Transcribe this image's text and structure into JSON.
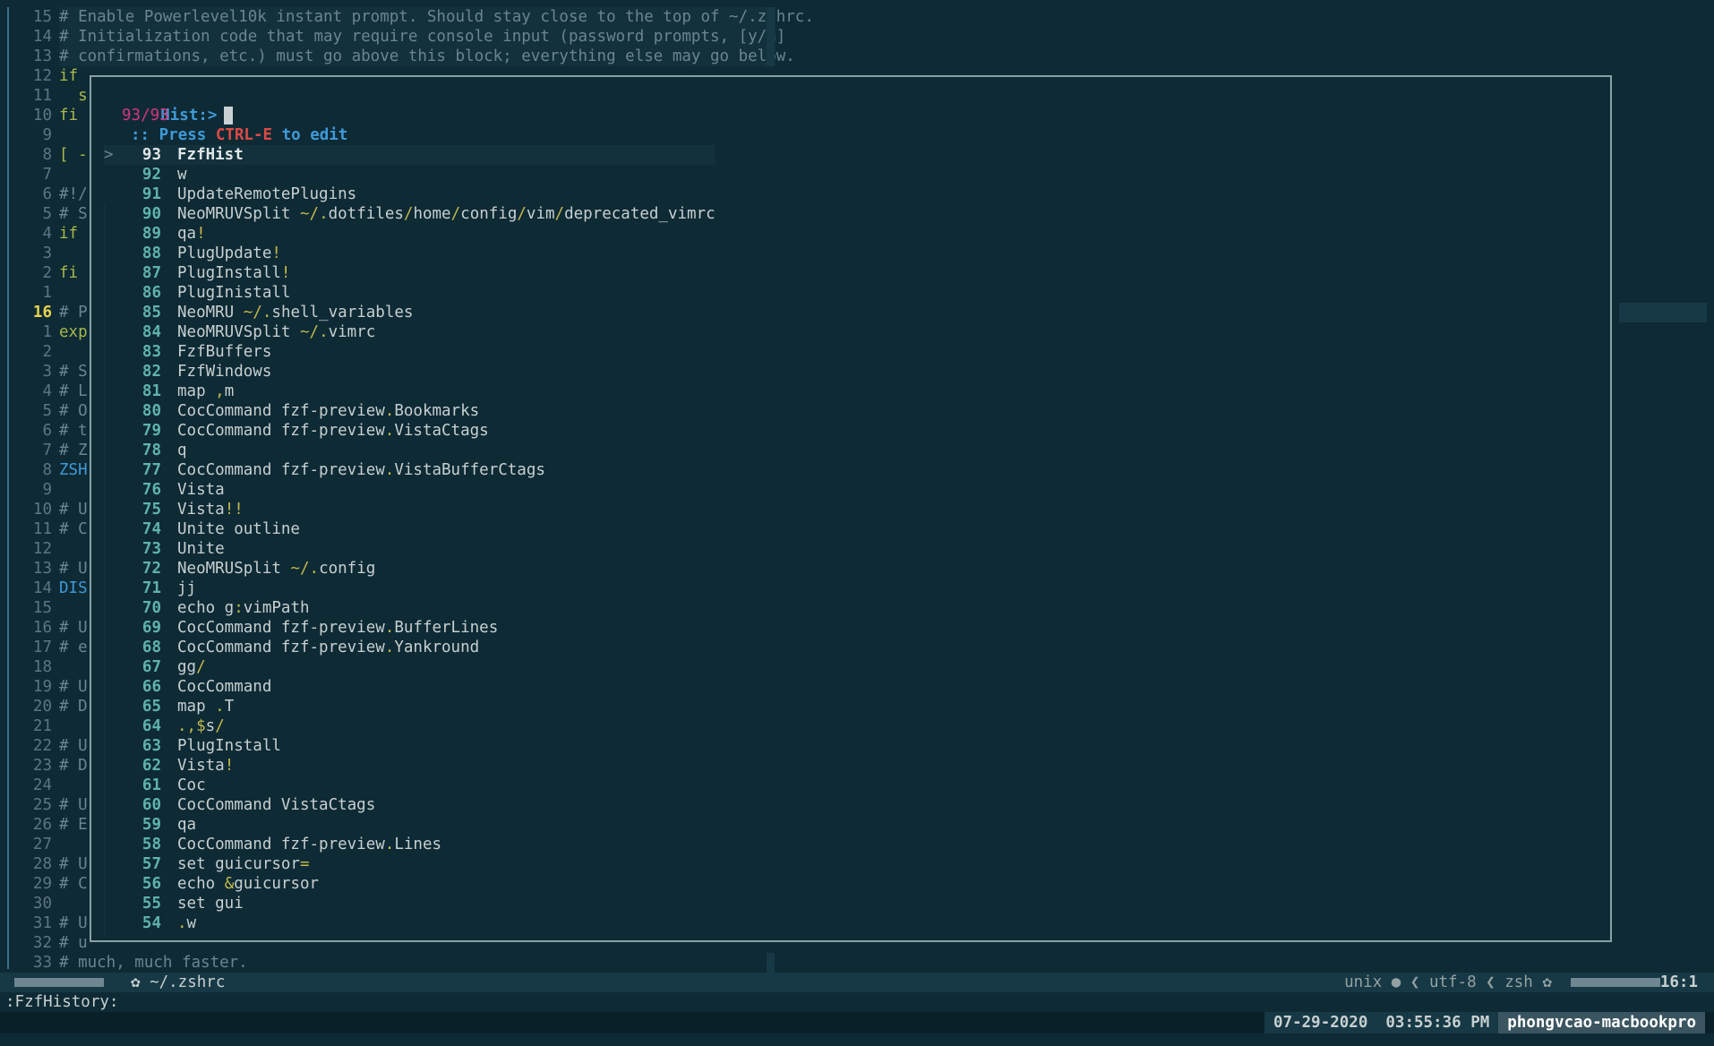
{
  "editor": {
    "gutter_numbers": [
      "15",
      "14",
      "13",
      "12",
      "11",
      "10",
      "9",
      "8",
      "7",
      "6",
      "5",
      "4",
      "3",
      "2",
      "1",
      "16",
      "1",
      "2",
      "3",
      "4",
      "5",
      "6",
      "7",
      "8",
      "9",
      "10",
      "11",
      "12",
      "13",
      "14",
      "15",
      "16",
      "17",
      "18",
      "19",
      "20",
      "21",
      "22",
      "23",
      "24",
      "25",
      "26",
      "27",
      "28",
      "29",
      "30",
      "31",
      "32",
      "33"
    ],
    "code_lines": [
      "# Enable Powerlevel10k instant prompt. Should stay close to the top of ~/.zshrc.",
      "# Initialization code that may require console input (password prompts, [y/n]",
      "# confirmations, etc.) must go above this block; everything else may go below.",
      "if",
      "  s",
      "fi",
      "",
      "[ -",
      "",
      "#!/",
      "# S",
      "if",
      "",
      "fi",
      "",
      "# P",
      "exp",
      "",
      "# S",
      "# L",
      "# O",
      "# t",
      "# Z",
      "ZSH",
      "",
      "# U",
      "# C",
      "",
      "# U",
      "DIS",
      "",
      "# U",
      "# e",
      "",
      "# U",
      "# D",
      "",
      "# U",
      "# D",
      "",
      "# U",
      "# E",
      "",
      "# U",
      "# C",
      "",
      "# U",
      "# u",
      "# much, much faster."
    ]
  },
  "popup": {
    "prompt_label": "Hist:>",
    "count": "93/93",
    "hint_prefix": ":: Press ",
    "hint_key": "CTRL-E",
    "hint_suffix": " to edit",
    "pointer": ">",
    "items": [
      {
        "n": "93",
        "cmd": "FzfHist"
      },
      {
        "n": "92",
        "cmd": "w"
      },
      {
        "n": "91",
        "cmd": "UpdateRemotePlugins"
      },
      {
        "n": "90",
        "cmd": "NeoMRUVSplit ~/.dotfiles/home/config/vim/deprecated_vimrc"
      },
      {
        "n": "89",
        "cmd": "qa!"
      },
      {
        "n": "88",
        "cmd": "PlugUpdate!"
      },
      {
        "n": "87",
        "cmd": "PlugInstall!"
      },
      {
        "n": "86",
        "cmd": "PlugInistall"
      },
      {
        "n": "85",
        "cmd": "NeoMRU ~/.shell_variables"
      },
      {
        "n": "84",
        "cmd": "NeoMRUVSplit ~/.vimrc"
      },
      {
        "n": "83",
        "cmd": "FzfBuffers"
      },
      {
        "n": "82",
        "cmd": "FzfWindows"
      },
      {
        "n": "81",
        "cmd": "map ,m"
      },
      {
        "n": "80",
        "cmd": "CocCommand fzf-preview.Bookmarks"
      },
      {
        "n": "79",
        "cmd": "CocCommand fzf-preview.VistaCtags"
      },
      {
        "n": "78",
        "cmd": "q"
      },
      {
        "n": "77",
        "cmd": "CocCommand fzf-preview.VistaBufferCtags"
      },
      {
        "n": "76",
        "cmd": "Vista"
      },
      {
        "n": "75",
        "cmd": "Vista!!"
      },
      {
        "n": "74",
        "cmd": "Unite outline"
      },
      {
        "n": "73",
        "cmd": "Unite"
      },
      {
        "n": "72",
        "cmd": "NeoMRUSplit ~/.config"
      },
      {
        "n": "71",
        "cmd": "jj"
      },
      {
        "n": "70",
        "cmd": "echo g:vimPath"
      },
      {
        "n": "69",
        "cmd": "CocCommand fzf-preview.BufferLines"
      },
      {
        "n": "68",
        "cmd": "CocCommand fzf-preview.Yankround"
      },
      {
        "n": "67",
        "cmd": "gg/"
      },
      {
        "n": "66",
        "cmd": "CocCommand"
      },
      {
        "n": "65",
        "cmd": "map .T"
      },
      {
        "n": "64",
        "cmd": ".,$s/"
      },
      {
        "n": "63",
        "cmd": "PlugInstall"
      },
      {
        "n": "62",
        "cmd": "Vista!"
      },
      {
        "n": "61",
        "cmd": "Coc"
      },
      {
        "n": "60",
        "cmd": "CocCommand VistaCtags"
      },
      {
        "n": "59",
        "cmd": "qa"
      },
      {
        "n": "58",
        "cmd": "CocCommand fzf-preview.Lines"
      },
      {
        "n": "57",
        "cmd": "set guicursor="
      },
      {
        "n": "56",
        "cmd": "echo &guicursor"
      },
      {
        "n": "55",
        "cmd": "set gui"
      },
      {
        "n": "54",
        "cmd": ".w"
      }
    ]
  },
  "statusline": {
    "filename": "~/.zshrc",
    "fileformat": "unix",
    "encoding": "utf-8",
    "filetype": "zsh",
    "position": "16:1"
  },
  "cmdline": {
    "text": ":FzfHistory:"
  },
  "tmux": {
    "date": "07-29-2020",
    "time": "03:55:36 PM",
    "host": "phongvcao-macbookpro"
  },
  "colors": {
    "background": "#0e2a35",
    "accent_blue": "#3f9ad8",
    "accent_magenta": "#d33682",
    "accent_red": "#dc4a45",
    "accent_yellow": "#e8d44d"
  }
}
